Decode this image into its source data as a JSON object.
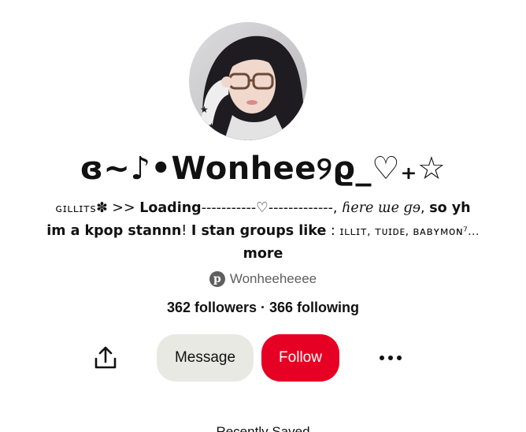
{
  "profile": {
    "display_name": "ɞ~♪•Wonhee୨ϱ_♡₊☆",
    "username": "Wonheeheeee",
    "avatar_alt": "profile photo"
  },
  "bio": {
    "l1_a": "ɢɪʟʟɪᴛs",
    "l1_b": "✽",
    "l1_c": " >> ",
    "l1_d": "Loading",
    "l1_e": "-----------♡-------------,",
    "l1_f": " ɦere ɯe ɡɘ",
    "l1_g": ", ",
    "l1_h": "so yh",
    "l2_a": "im a kpop stannn",
    "l2_b": "! ",
    "l2_c": "I stan groups like",
    "l2_d": " : ",
    "l2_e": "ɪʟʟɪᴛ, ᴛᴜɪᴅᴇ, ʙᴀʙʏᴍᴏɴ⁷...",
    "more_label": "more"
  },
  "stats": {
    "followers": "362 followers",
    "separator": " · ",
    "following": "366 following"
  },
  "actions": {
    "share_icon": "share-icon",
    "message_label": "Message",
    "follow_label": "Follow",
    "more_icon": "more-options-icon"
  },
  "colors": {
    "follow_red": "#e60023",
    "message_gray": "#e9e9e4",
    "muted_text": "#5f5f5f"
  },
  "footer_partial": "Recently Saved"
}
